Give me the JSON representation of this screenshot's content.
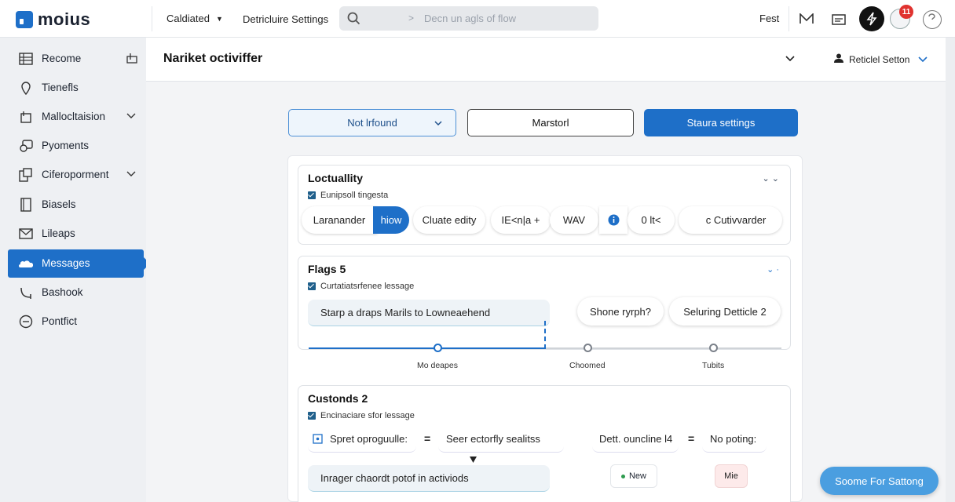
{
  "app": {
    "name": "moius",
    "brand_color": "#1e6fc8"
  },
  "topbar": {
    "dropdown_label": "Caldiated",
    "link_label": "Detricluire Settings",
    "search_placeholder": "Decn un agls of flow",
    "right_text": "Fest",
    "notification_count": "11",
    "icons": [
      "search-icon",
      "mail-icon",
      "folder-icon",
      "bolt-icon",
      "bell-icon",
      "help-icon"
    ]
  },
  "sidebar": {
    "items": [
      {
        "label": "Recome",
        "icon": "grid-icon",
        "right": "collapse-icon"
      },
      {
        "label": "Tienefls",
        "icon": "pin-icon"
      },
      {
        "label": "Mallocltaision",
        "icon": "box-icon",
        "right": "chevron-down-icon"
      },
      {
        "label": "Pyoments",
        "icon": "chat-icon"
      },
      {
        "label": "Ciferoporment",
        "icon": "copy-icon",
        "right": "chevron-down-icon"
      },
      {
        "label": "Biasels",
        "icon": "doc-icon"
      },
      {
        "label": "Lileaps",
        "icon": "mail-icon"
      },
      {
        "label": "Messages",
        "icon": "cloud-icon",
        "active": true
      },
      {
        "label": "Bashook",
        "icon": "hook-icon"
      },
      {
        "label": "Pontfict",
        "icon": "minus-circle-icon"
      }
    ]
  },
  "header": {
    "title": "Nariket octiviffer",
    "user": "Reticlel Setton"
  },
  "actions": {
    "primary_outline": "Not lrfound",
    "secondary": "Marstorl",
    "primary": "Staura settings"
  },
  "sections": {
    "locality": {
      "title": "Loctuallity",
      "check_label": "Eunipsoll tingesta",
      "chips": [
        "Laranander",
        "hiow",
        "Cluate edity",
        "IE<n|a +",
        "WAV",
        "0 lt<",
        "c Cutivvarder"
      ]
    },
    "flags": {
      "title": "Flags 5",
      "check_label": "Curtatiatsrfenee lessage",
      "input_value": "Starp a draps Marils to Lowneaehend",
      "chips": [
        "Shone ryrph?",
        "Seluring Detticle 2"
      ],
      "progress": {
        "value": 0.5,
        "steps": [
          "Mo deapes",
          "Choomed",
          "Tubits"
        ]
      }
    },
    "customs": {
      "title": "Custonds 2",
      "check_label": "Encinaciare sfor lessage",
      "row1_left": "Spret oproguulle:",
      "row1_mid": "Seer ectorfly sealitss",
      "row1_right_a": "Dett. ouncline l4",
      "row1_right_b": "No poting:",
      "row2_input": "Inrager chaordt potof in activiods",
      "tag_new": "New",
      "tag_mie": "Mie"
    }
  },
  "floating_button": "Soome For Sattong"
}
